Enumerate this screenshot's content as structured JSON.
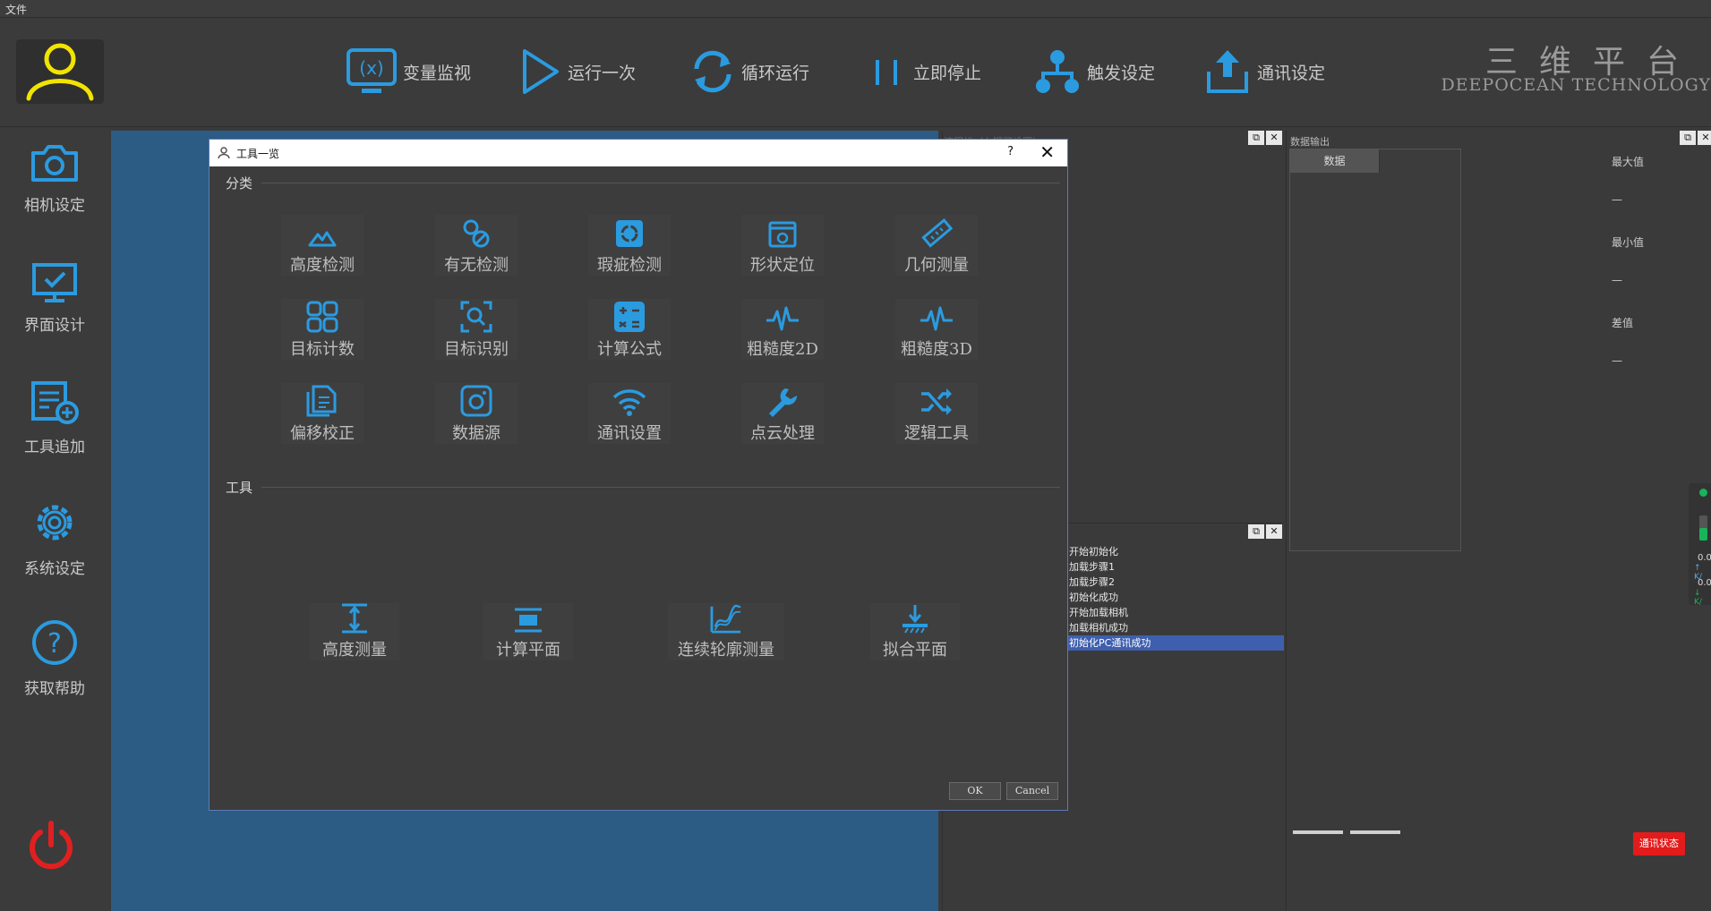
{
  "menu": {
    "file": "文件"
  },
  "toolbar": {
    "buttons": [
      {
        "label": "变量监视",
        "icon": "variable-monitor-icon"
      },
      {
        "label": "运行一次",
        "icon": "play-icon"
      },
      {
        "label": "循环运行",
        "icon": "loop-icon"
      },
      {
        "label": "立即停止",
        "icon": "pause-icon"
      },
      {
        "label": "触发设定",
        "icon": "trigger-icon"
      },
      {
        "label": "通讯设定",
        "icon": "upload-icon"
      }
    ],
    "brand_cn": "三维平台",
    "brand_en": "DEEPOCEAN TECHNOLOGY"
  },
  "sidebar": {
    "items": [
      {
        "label": "相机设定",
        "icon": "camera-icon"
      },
      {
        "label": "界面设计",
        "icon": "monitor-check-icon"
      },
      {
        "label": "工具追加",
        "icon": "add-tool-icon"
      },
      {
        "label": "系统设定",
        "icon": "gear-icon"
      },
      {
        "label": "获取帮助",
        "icon": "help-icon"
      }
    ],
    "power_icon": "power-icon"
  },
  "flow_panel": {
    "title": "流程栏（右键可设置）"
  },
  "log": {
    "items": [
      "开始初始化",
      "加载步骤1",
      "加载步骤2",
      "初始化成功",
      "开始加载相机",
      "加载相机成功",
      "初始化PC通讯成功"
    ],
    "selected_index": 6
  },
  "data_panel": {
    "title": "数据输出",
    "column": "数据",
    "max_label": "最大值",
    "max_value": "—",
    "min_label": "最小值",
    "min_value": "—",
    "diff_label": "差值",
    "diff_value": "—",
    "comm_status": "通讯状态",
    "side_values": [
      "0.0",
      "0.0"
    ],
    "side_units": [
      "K/",
      "K/"
    ]
  },
  "dialog": {
    "title": "工具一览",
    "help": "?",
    "close": "✕",
    "category_label": "分类",
    "tools_label": "工具",
    "categories": [
      {
        "label": "高度检测",
        "icon": "height-detect-icon"
      },
      {
        "label": "有无检测",
        "icon": "presence-detect-icon"
      },
      {
        "label": "瑕疵检测",
        "icon": "defect-detect-icon"
      },
      {
        "label": "形状定位",
        "icon": "shape-locate-icon"
      },
      {
        "label": "几何测量",
        "icon": "ruler-icon"
      },
      {
        "label": "目标计数",
        "icon": "grid-count-icon"
      },
      {
        "label": "目标识别",
        "icon": "target-recognize-icon"
      },
      {
        "label": "计算公式",
        "icon": "calculator-icon"
      },
      {
        "label": "粗糙度2D",
        "icon": "roughness-2d-icon"
      },
      {
        "label": "粗糙度3D",
        "icon": "roughness-3d-icon"
      },
      {
        "label": "偏移校正",
        "icon": "offset-correct-icon"
      },
      {
        "label": "数据源",
        "icon": "data-source-icon"
      },
      {
        "label": "通讯设置",
        "icon": "wifi-icon"
      },
      {
        "label": "点云处理",
        "icon": "wrench-icon"
      },
      {
        "label": "逻辑工具",
        "icon": "shuffle-icon"
      }
    ],
    "tools": [
      {
        "label": "高度测量",
        "icon": "height-measure-icon"
      },
      {
        "label": "计算平面",
        "icon": "plane-calc-icon"
      },
      {
        "label": "连续轮廓测量",
        "icon": "contour-measure-icon"
      },
      {
        "label": "拟合平面",
        "icon": "fit-plane-icon"
      }
    ],
    "ok": "OK",
    "cancel": "Cancel"
  },
  "colors": {
    "accent": "#2b9be0",
    "canvas": "#2c5b84",
    "avatar": "#f2e400",
    "power": "#e02020",
    "status": "#e31b1b",
    "selection": "#3f5fae"
  }
}
